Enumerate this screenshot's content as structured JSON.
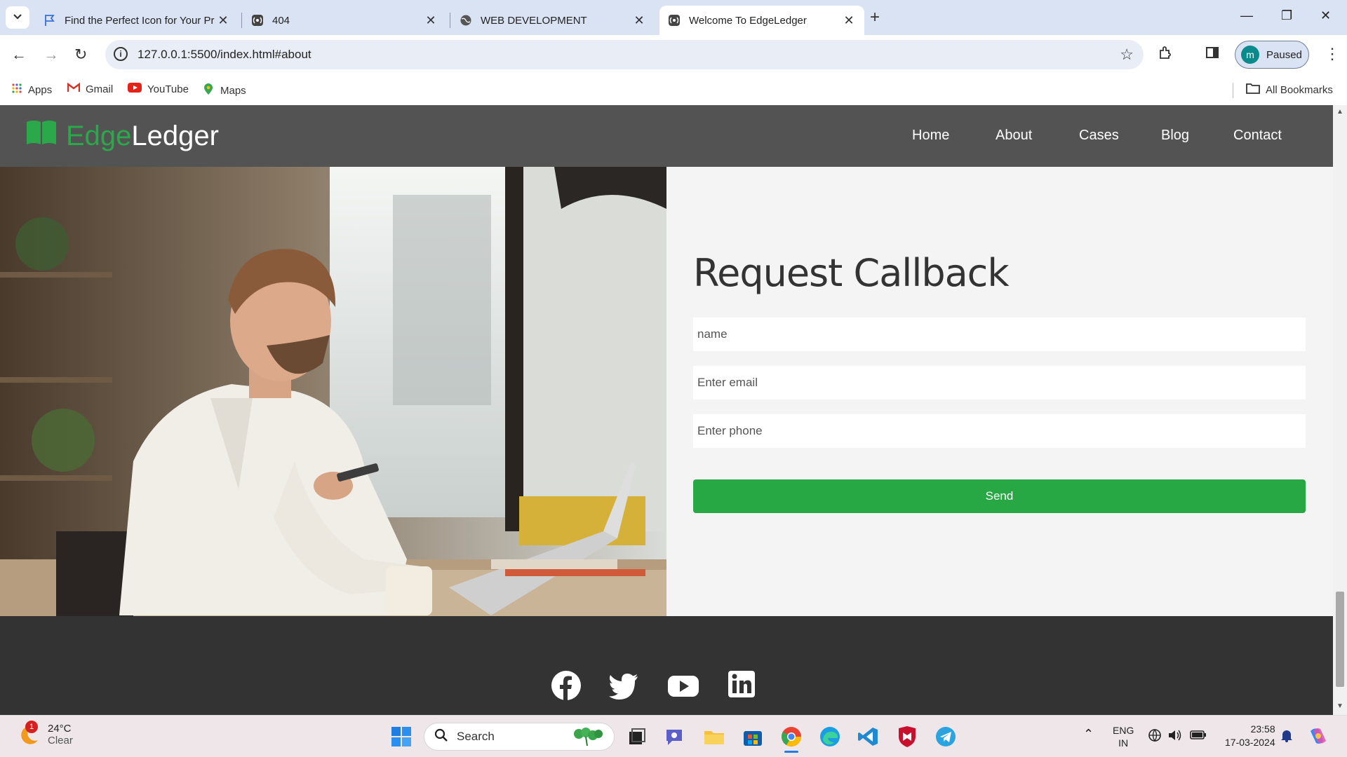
{
  "browser": {
    "tabs": [
      {
        "title": "Find the Perfect Icon for Your Pr",
        "favicon": "flag-icon",
        "active": false
      },
      {
        "title": "404",
        "favicon": "radio-wave-icon",
        "active": false
      },
      {
        "title": "WEB DEVELOPMENT",
        "favicon": "globe-icon",
        "active": false
      },
      {
        "title": "Welcome To EdgeLedger",
        "favicon": "radio-wave-icon",
        "active": true
      }
    ],
    "url": "127.0.0.1:5500/index.html#about",
    "profile_label": "Paused",
    "profile_initial": "m",
    "bookmarks": [
      {
        "label": "Apps",
        "icon": "apps-grid-icon"
      },
      {
        "label": "Gmail",
        "icon": "gmail-icon"
      },
      {
        "label": "YouTube",
        "icon": "youtube-icon"
      },
      {
        "label": "Maps",
        "icon": "maps-icon"
      }
    ],
    "all_bookmarks": "All Bookmarks"
  },
  "site": {
    "logo_part1": "Edge",
    "logo_part2": "Ledger",
    "nav": [
      "Home",
      "About",
      "Cases",
      "Blog",
      "Contact"
    ],
    "colors": {
      "accent": "#28a745",
      "header": "#535353",
      "footer": "#333333"
    }
  },
  "form": {
    "title": "Request Callback",
    "name_placeholder": "name",
    "email_placeholder": "Enter email",
    "phone_placeholder": "Enter phone",
    "send_label": "Send"
  },
  "footer": {
    "social": [
      "facebook-icon",
      "twitter-icon",
      "youtube-icon",
      "linkedin-icon"
    ]
  },
  "taskbar": {
    "weather_temp": "24°C",
    "weather_desc": "Clear",
    "weather_badge": "1",
    "search_label": "Search",
    "lang_line1": "ENG",
    "lang_line2": "IN",
    "time": "23:58",
    "date": "17-03-2024"
  }
}
